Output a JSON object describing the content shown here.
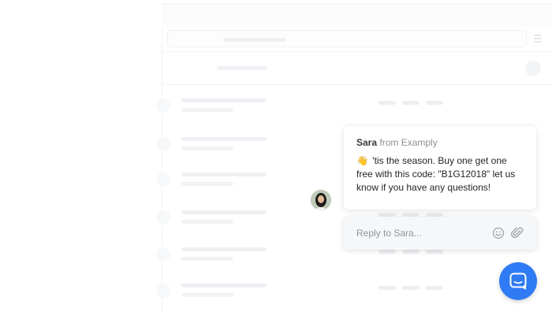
{
  "messenger": {
    "message": {
      "sender_name": "Sara",
      "sender_org": "from Examply",
      "emoji": "👋",
      "text": "'tis the season. Buy one get one free with this code: \"B1G12018\" let us know if you have any questions!"
    },
    "reply": {
      "placeholder": "Reply to Sara..."
    },
    "icons": {
      "wave": "waving-hand-icon",
      "emoji": "smiley-face-icon",
      "attach": "paperclip-icon",
      "launcher": "chat-bubble-icon"
    }
  },
  "colors": {
    "launcher": "#2f7bf5",
    "sender_name": "#353a3f",
    "sender_org": "#8a8f95",
    "reply_background": "#f6f7f9"
  }
}
